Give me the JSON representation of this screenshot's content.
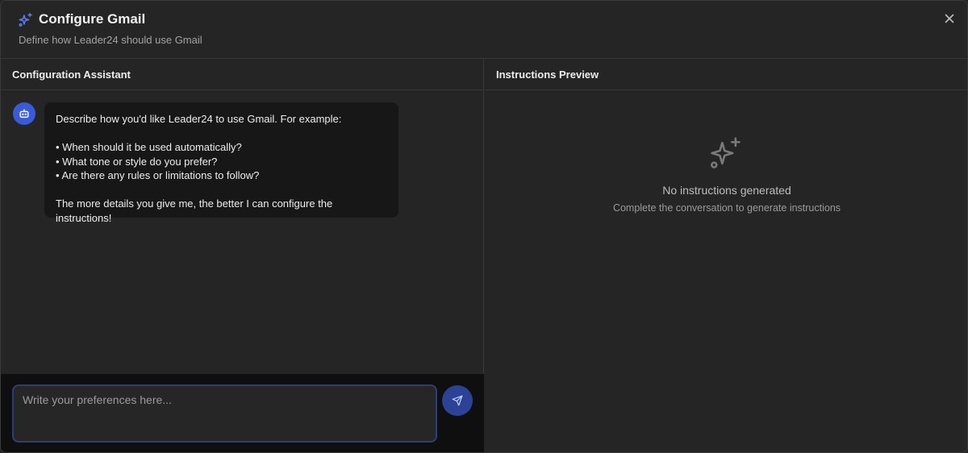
{
  "header": {
    "title": "Configure Gmail",
    "subtitle": "Define how Leader24 should use Gmail",
    "title_icon": "sparkles-icon",
    "close_icon": "close-icon"
  },
  "assistant": {
    "header": "Configuration Assistant",
    "avatar_icon": "bot-icon",
    "message": {
      "intro": "Describe how you'd like Leader24 to use Gmail. For example:",
      "bullets": [
        "• When should it be used automatically?",
        "• What tone or style do you prefer?",
        "• Are there any rules or limitations to follow?"
      ],
      "outro": "The more details you give me, the better I can configure the instructions!"
    },
    "input": {
      "placeholder": "Write your preferences here...",
      "value": ""
    },
    "send_icon": "send-icon"
  },
  "preview": {
    "header": "Instructions Preview",
    "empty_icon": "sparkles-icon",
    "empty_title": "No instructions generated",
    "empty_subtitle": "Complete the conversation to generate instructions"
  },
  "colors": {
    "background": "#252525",
    "accent": "#3a5bd9",
    "bubble": "#171717",
    "composer": "#0f0f0f"
  }
}
